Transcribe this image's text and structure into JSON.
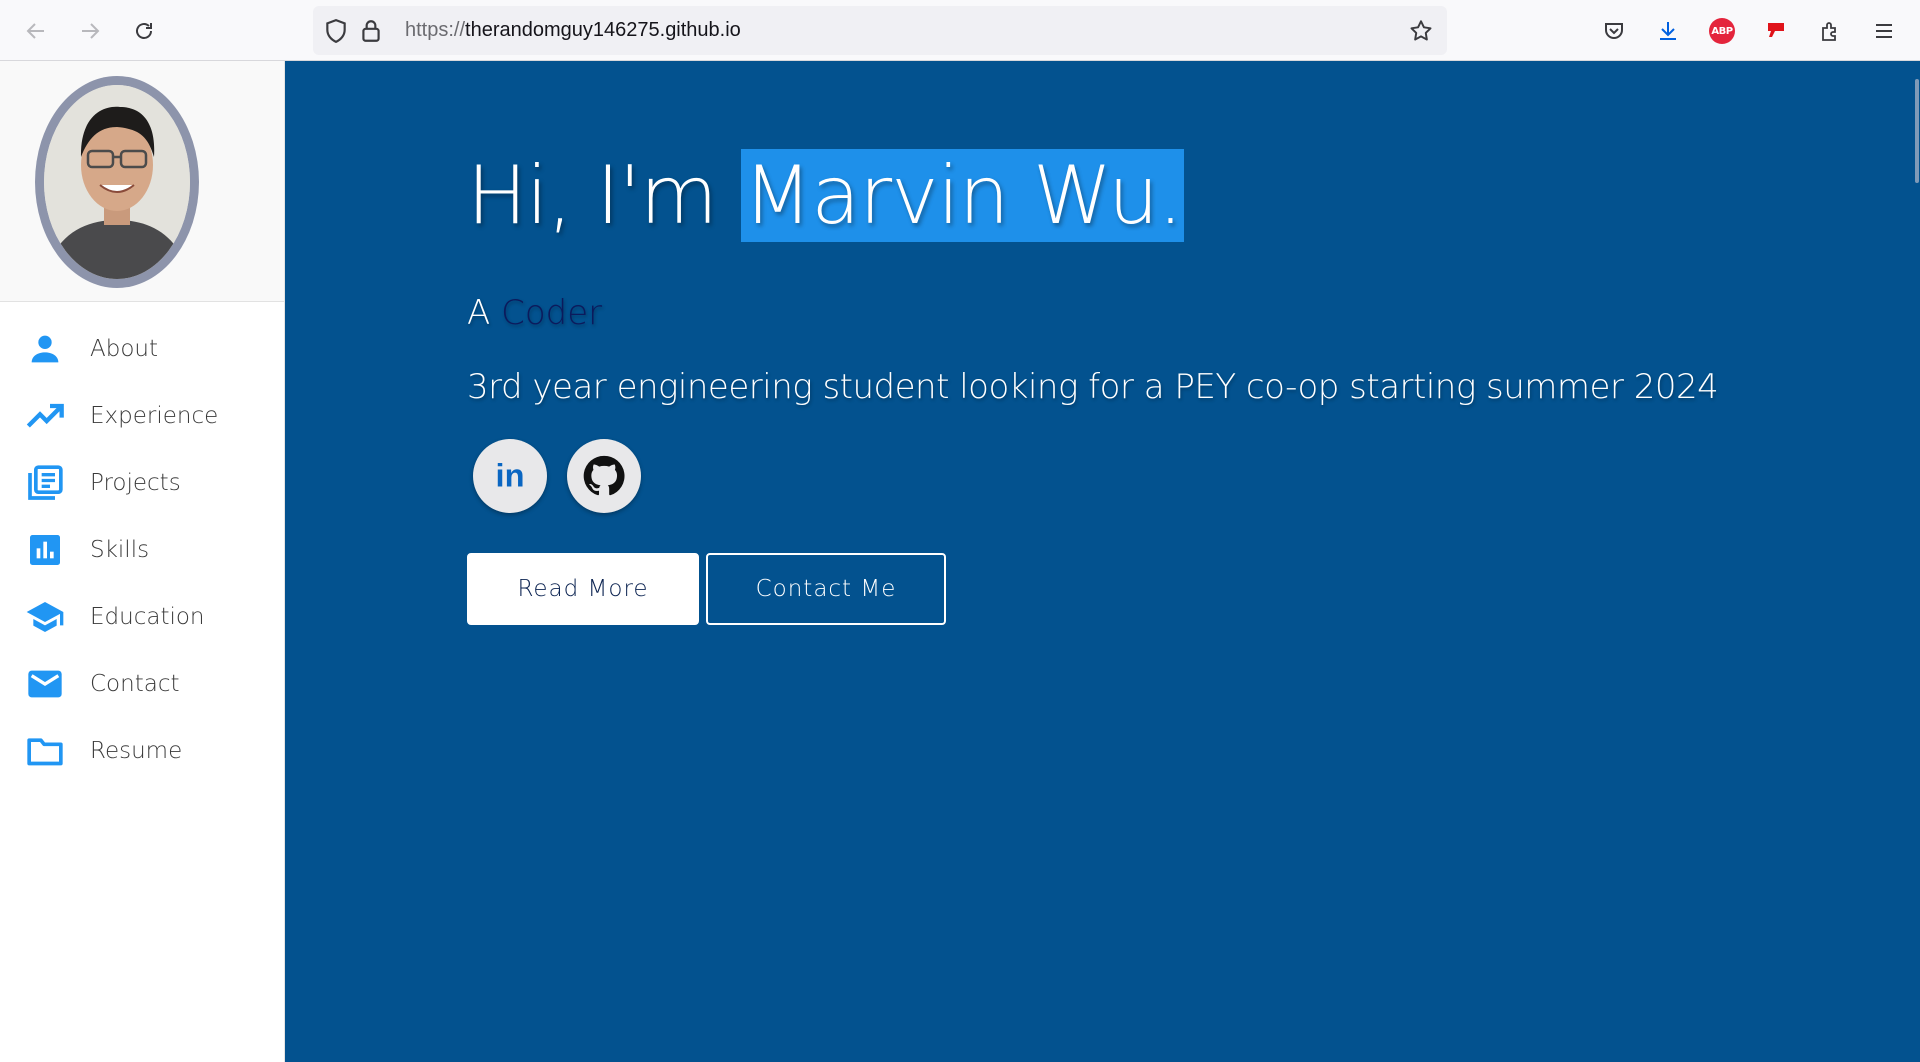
{
  "browser": {
    "url_protocol": "https://",
    "url_host": "therandomguy146275.github.io",
    "icons": [
      "back-icon",
      "forward-icon",
      "reload-icon",
      "shield-icon",
      "lock-icon",
      "star-icon",
      "pocket-icon",
      "download-icon",
      "adblock-icon",
      "extension-icon",
      "puzzle-icon",
      "menu-icon"
    ],
    "abp_label": "ABP"
  },
  "sidebar": {
    "items": [
      {
        "label": "About",
        "icon": "person-icon"
      },
      {
        "label": "Experience",
        "icon": "trending-up-icon"
      },
      {
        "label": "Projects",
        "icon": "library-books-icon"
      },
      {
        "label": "Skills",
        "icon": "bar-chart-icon"
      },
      {
        "label": "Education",
        "icon": "school-icon"
      },
      {
        "label": "Contact",
        "icon": "mail-icon"
      },
      {
        "label": "Resume",
        "icon": "folder-icon"
      }
    ]
  },
  "hero": {
    "greeting": "Hi, I'm ",
    "name": "Marvin Wu.",
    "role_prefix": "A ",
    "role": "Coder",
    "subtitle": "3rd year engineering student looking for a PEY co-op starting summer 2024",
    "socials": [
      {
        "name": "linkedin",
        "label": "in"
      },
      {
        "name": "github"
      }
    ],
    "read_more": "Read More",
    "contact_me": "Contact Me"
  },
  "colors": {
    "hero_bg": "#03528f",
    "highlight": "#1e90ea",
    "accent": "#2196f3",
    "role_text": "#0c1a5c"
  }
}
